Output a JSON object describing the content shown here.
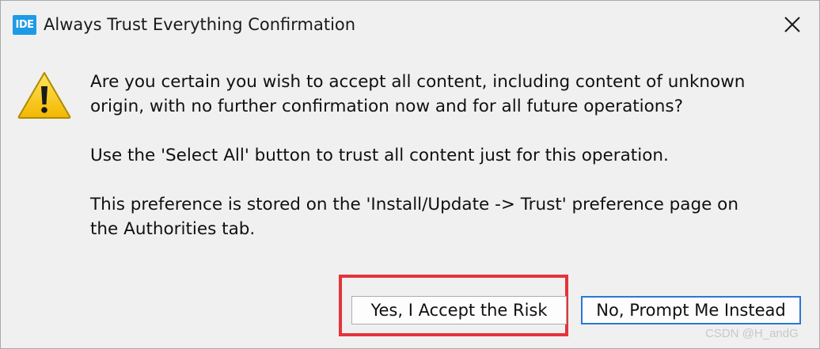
{
  "window": {
    "app_icon_text": "IDE",
    "title": "Always Trust Everything Confirmation"
  },
  "message": {
    "line1": "Are you certain you wish to accept all content, including content of unknown",
    "line2": "origin, with no further confirmation now and for all future operations?",
    "line3": "Use the 'Select All' button to trust all content just for this operation.",
    "line4": "This preference is stored on the 'Install/Update -> Trust' preference page on",
    "line5": "the Authorities tab."
  },
  "buttons": {
    "accept_label": "Yes, I Accept the Risk",
    "prompt_label": "No, Prompt Me Instead"
  },
  "watermark": "CSDN @H_andG",
  "colors": {
    "app_icon_bg": "#1f9be6",
    "highlight_border": "#e5333a",
    "default_button_border": "#2a78d4",
    "warning_yellow": "#f5c400"
  },
  "icons": {
    "app": "ide-logo-icon",
    "close": "close-icon",
    "warning": "warning-icon"
  }
}
